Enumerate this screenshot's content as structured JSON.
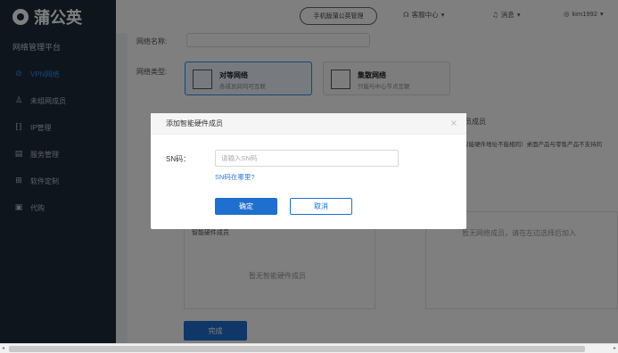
{
  "brand": {
    "name": "蒲公英",
    "platform": "网络管理平台"
  },
  "sidebar": {
    "items": [
      {
        "label": "VPN网络",
        "icon": "network-icon",
        "glyph": "⊘",
        "active": true
      },
      {
        "label": "未组网成员",
        "icon": "user-icon",
        "glyph": "♙",
        "active": false
      },
      {
        "label": "IP管理",
        "icon": "ip-icon",
        "glyph": "⁅⁆",
        "active": false
      },
      {
        "label": "服务管理",
        "icon": "service-icon",
        "glyph": "▤",
        "active": false
      },
      {
        "label": "软件定制",
        "icon": "grid-icon",
        "glyph": "⊞",
        "active": false
      },
      {
        "label": "代购",
        "icon": "cart-icon",
        "glyph": "▣",
        "active": false
      }
    ]
  },
  "topbar": {
    "mobile_manage": "手机版蒲公英管理",
    "help_center": "客服中心",
    "messages": "消息",
    "user": "kim1992"
  },
  "form": {
    "network_name_label": "网络名称:",
    "network_type_label": "网络类型:",
    "types": [
      {
        "title": "对等网络",
        "subtitle": "各成员间均可互联"
      },
      {
        "title": "集散网络",
        "subtitle": "只能与中心节点互联"
      }
    ],
    "members_header_fragment": "员成员",
    "members_tip_fragment": "智能硬件地址不能相同）桌面产品与零售产品不支持同",
    "hardware_members_header": "智能硬件成员",
    "no_hardware_members": "暂无智能硬件成员",
    "no_network_members": "暂无网络成员，请在左边选择后加入",
    "done_label": "完成"
  },
  "modal": {
    "title": "添加智能硬件成员",
    "sn_label": "SN码：",
    "sn_placeholder": "请输入SN码",
    "sn_help_link": "SN码在哪里?",
    "ok_label": "确定",
    "cancel_label": "取消"
  },
  "colors": {
    "accent": "#1f6fcf",
    "sidebar_bg": "#1e2a38",
    "link": "#2f7ad8"
  }
}
